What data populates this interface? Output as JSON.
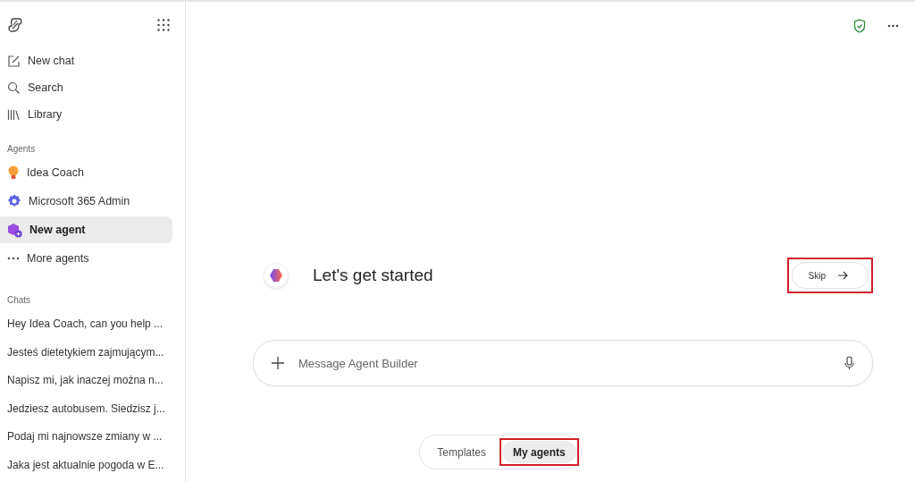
{
  "sidebar": {
    "nav": [
      {
        "kind": "compose",
        "label": "New chat"
      },
      {
        "kind": "search",
        "label": "Search"
      },
      {
        "kind": "library",
        "label": "Library"
      }
    ],
    "agents_heading": "Agents",
    "agents": [
      {
        "kind": "bulb",
        "label": "Idea Coach",
        "selected": false
      },
      {
        "kind": "gear",
        "label": "Microsoft 365 Admin",
        "selected": false
      },
      {
        "kind": "new",
        "label": "New agent",
        "selected": true
      },
      {
        "kind": "more",
        "label": "More agents",
        "selected": false
      }
    ],
    "chats_heading": "Chats",
    "chats": [
      "Hey Idea Coach, can you help ...",
      "Jesteś dietetykiem zajmującym...",
      "Napisz mi, jak inaczej można n...",
      "Jedziesz autobusem. Siedzisz j...",
      "Podaj mi najnowsze zmiany w ...",
      "Jaka jest aktualnie pogoda w E..."
    ]
  },
  "main": {
    "greeting": "Let's get started",
    "skip": {
      "label": "Skip",
      "highlighted": true
    },
    "composer": {
      "placeholder": "Message Agent Builder"
    },
    "tabs": [
      {
        "label": "Templates",
        "selected": false,
        "highlighted": false
      },
      {
        "label": "My agents",
        "selected": true,
        "highlighted": true
      }
    ]
  }
}
